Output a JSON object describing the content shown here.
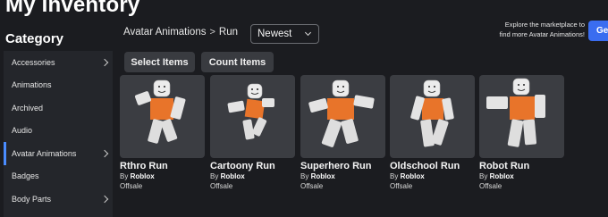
{
  "page": {
    "title": "My Inventory"
  },
  "sidebar": {
    "heading": "Category",
    "items": [
      {
        "label": "Accessories",
        "has_chevron": true,
        "active": false
      },
      {
        "label": "Animations",
        "has_chevron": false,
        "active": false
      },
      {
        "label": "Archived",
        "has_chevron": false,
        "active": false
      },
      {
        "label": "Audio",
        "has_chevron": false,
        "active": false
      },
      {
        "label": "Avatar Animations",
        "has_chevron": true,
        "active": true
      },
      {
        "label": "Badges",
        "has_chevron": false,
        "active": false
      },
      {
        "label": "Body Parts",
        "has_chevron": true,
        "active": false
      }
    ]
  },
  "breadcrumb": {
    "parent": "Avatar Animations",
    "separator": ">",
    "current": "Run"
  },
  "sort": {
    "selected": "Newest"
  },
  "toolbar": {
    "select_items": "Select Items",
    "count_items": "Count Items"
  },
  "promo": {
    "line1": "Explore the marketplace to",
    "line2": "find more Avatar Animations!",
    "button_label": "Ge"
  },
  "items": [
    {
      "name": "Rthro Run",
      "by_prefix": "By",
      "creator": "Roblox",
      "price": "Offsale"
    },
    {
      "name": "Cartoony Run",
      "by_prefix": "By",
      "creator": "Roblox",
      "price": "Offsale"
    },
    {
      "name": "Superhero Run",
      "by_prefix": "By",
      "creator": "Roblox",
      "price": "Offsale"
    },
    {
      "name": "Oldschool Run",
      "by_prefix": "By",
      "creator": "Roblox",
      "price": "Offsale"
    },
    {
      "name": "Robot Run",
      "by_prefix": "By",
      "creator": "Roblox",
      "price": "Offsale"
    }
  ],
  "colors": {
    "accent": "#4a8cff",
    "go_button": "#3a6df0",
    "shirt": "#e8742a",
    "skin": "#e9e9e9"
  }
}
